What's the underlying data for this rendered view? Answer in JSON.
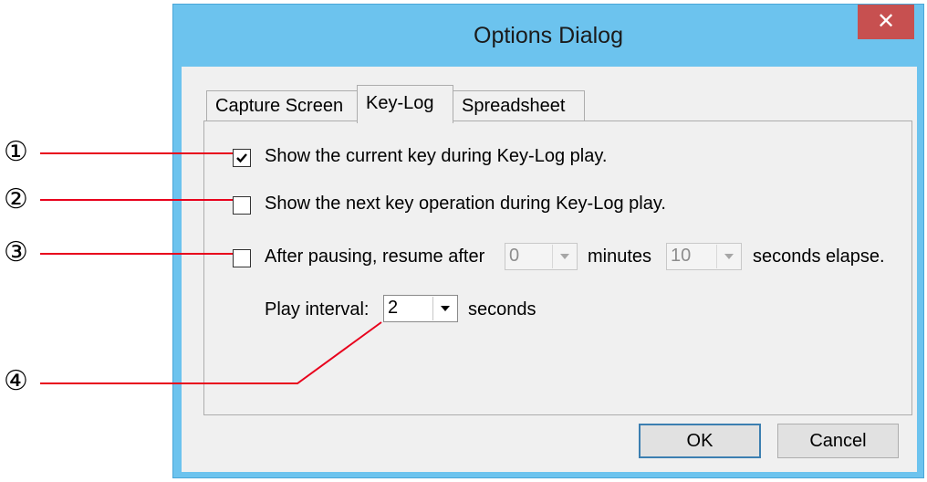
{
  "dialog": {
    "title": "Options Dialog",
    "close_symbol": "✕",
    "tabs": [
      {
        "label": "Capture Screen",
        "active": false
      },
      {
        "label": "Key-Log",
        "active": true
      },
      {
        "label": "Spreadsheet",
        "active": false
      }
    ]
  },
  "keylog": {
    "show_current_key": {
      "label": "Show the current key during Key-Log play.",
      "checked": true
    },
    "show_next_key": {
      "label": "Show the next key operation during Key-Log play.",
      "checked": false
    },
    "resume": {
      "checked": false,
      "label_before": "After pausing, resume after",
      "minutes_value": "0",
      "minutes_label": "minutes",
      "seconds_value": "10",
      "seconds_label": "seconds elapse."
    },
    "play_interval": {
      "label": "Play interval:",
      "value": "2",
      "unit": "seconds"
    }
  },
  "buttons": {
    "ok": "OK",
    "cancel": "Cancel"
  },
  "callouts": [
    "①",
    "②",
    "③",
    "④"
  ]
}
